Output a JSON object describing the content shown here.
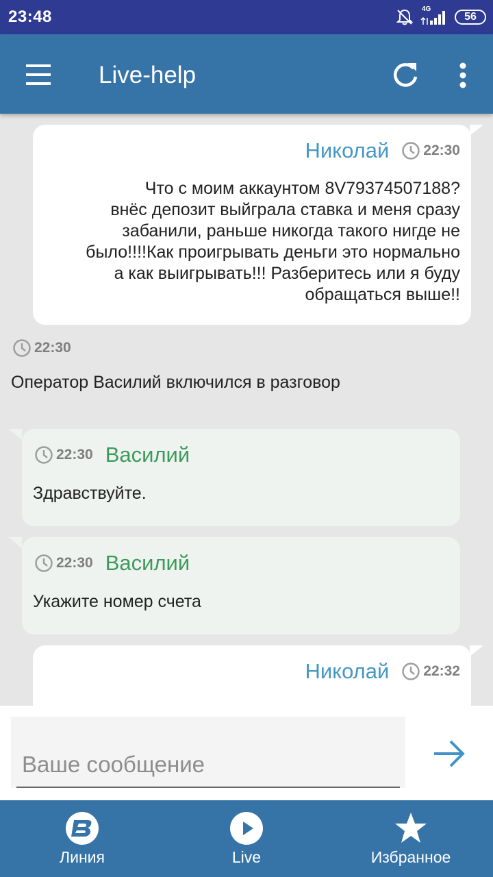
{
  "status_bar": {
    "time": "23:48",
    "network": "4G",
    "battery": "56",
    "icons": [
      "bell-off-icon",
      "signal-icon",
      "battery-icon"
    ]
  },
  "app_bar": {
    "title": "Live-help",
    "icons": [
      "menu-icon",
      "refresh-icon",
      "more-vert-icon"
    ]
  },
  "colors": {
    "status_bar_bg": "#2f3a93",
    "app_bar_bg": "#3674a8",
    "chat_bg": "#e6e6e6",
    "client_name": "#4597c4",
    "operator_name": "#3c9a5b",
    "operator_bubble_bg": "#eef3ef"
  },
  "messages": [
    {
      "author": "Николай",
      "time": "22:30",
      "lines": [
        "Что с моим аккаунтом 8V79374507188?",
        "внёс депозит выйграла ставка и меня сразу",
        "забанили, раньше никогда такого нигде не",
        "было!!!!Как проигрывать деньги это нормально",
        "а как выигрывать!!! Разберитесь или я буду",
        "обращаться выше!!"
      ]
    },
    {
      "time": "22:30",
      "text": "Оператор Василий включился в разговор"
    },
    {
      "author": "Василий",
      "time": "22:30",
      "text": "Здравствуйте."
    },
    {
      "author": "Василий",
      "time": "22:30",
      "text": "Укажите номер счета"
    },
    {
      "author": "Николай",
      "time": "22:32"
    }
  ],
  "composer": {
    "placeholder": "Ваше сообщение",
    "send_icon": "arrow-right-icon"
  },
  "bottom_nav": {
    "items": [
      {
        "label": "Линия",
        "icon": "line-logo-icon"
      },
      {
        "label": "Live",
        "icon": "play-circle-icon"
      },
      {
        "label": "Избранное",
        "icon": "star-icon"
      }
    ]
  }
}
